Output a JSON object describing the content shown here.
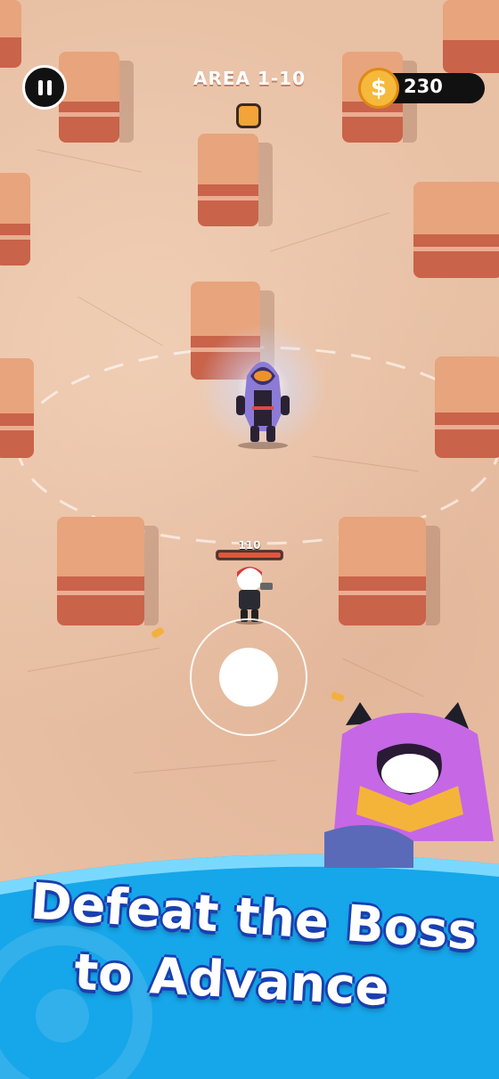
{
  "hud": {
    "pause_icon": "pause-icon",
    "area_label": "AREA 1-10",
    "coin_symbol": "$",
    "coins": "230"
  },
  "player": {
    "health": "110",
    "health_fraction": 1.0
  },
  "banner": {
    "line1": "Defeat the Boss",
    "line2": "to Advance"
  },
  "colors": {
    "ground": "#e8c0a4",
    "rock_top": "#e8a47c",
    "rock_side": "#c9634a",
    "coin": "#f6b93b",
    "banner_blue": "#1aa3e8",
    "text_outline": "#1a3fb0",
    "boss_cloak": "#8b7bd6"
  }
}
